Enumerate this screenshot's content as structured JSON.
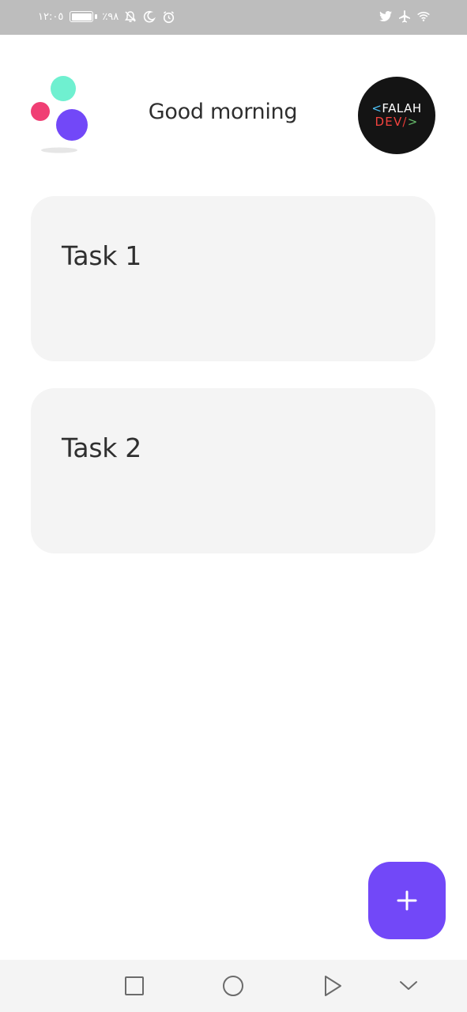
{
  "status_bar": {
    "time": "١٢:٠٥",
    "battery_percent": "٪٩٨",
    "icons": [
      "battery-icon",
      "notifications-off-icon",
      "moon-icon",
      "alarm-icon",
      "twitter-icon",
      "airplane-icon",
      "wifi-icon"
    ]
  },
  "header": {
    "greeting": "Good morning",
    "avatar": {
      "line1_prefix": "<",
      "line1_text": "FALAH",
      "line2_text": "DEV",
      "line2_slash": "/",
      "line2_suffix": ">"
    }
  },
  "tasks": [
    {
      "title": "Task 1"
    },
    {
      "title": "Task 2"
    }
  ],
  "fab": {
    "icon": "plus-icon"
  },
  "nav_bar": {
    "icons": [
      "square-icon",
      "circle-icon",
      "triangle-icon",
      "chevron-down-icon"
    ]
  },
  "colors": {
    "accent": "#7248f8",
    "status_bar": "#bdbdbd",
    "card": "#f4f4f4",
    "logo_teal": "#6ff0d0",
    "logo_pink": "#f03f74",
    "logo_purple": "#7248f8"
  }
}
